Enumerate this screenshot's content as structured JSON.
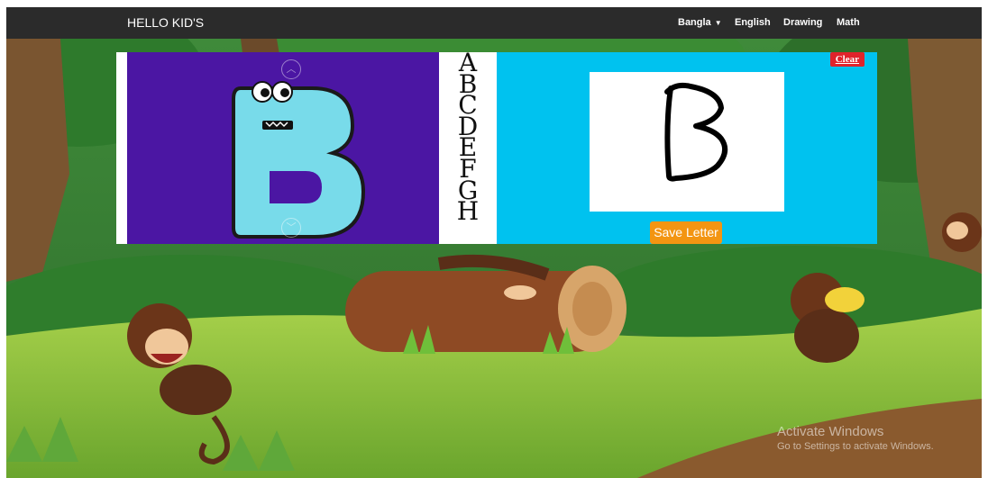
{
  "navbar": {
    "brand": "HELLO KID'S",
    "items": [
      {
        "label": "Bangla",
        "has_dropdown": true
      },
      {
        "label": "English"
      },
      {
        "label": "Drawing"
      },
      {
        "label": "Math"
      }
    ],
    "background": "#2b2b2b"
  },
  "left_card": {
    "current_letter": "B",
    "background": "#4b16a3",
    "up_icon": "chevron-up-icon",
    "down_icon": "chevron-down-icon"
  },
  "alphabet": [
    "A",
    "B",
    "C",
    "D",
    "E",
    "F",
    "G",
    "H"
  ],
  "right_card": {
    "background": "#00c2ef",
    "clear_label": "Clear",
    "save_label": "Save Letter",
    "drawn_letter": "B"
  },
  "watermark": {
    "line1": "Activate Windows",
    "line2": "Go to Settings to activate Windows."
  }
}
